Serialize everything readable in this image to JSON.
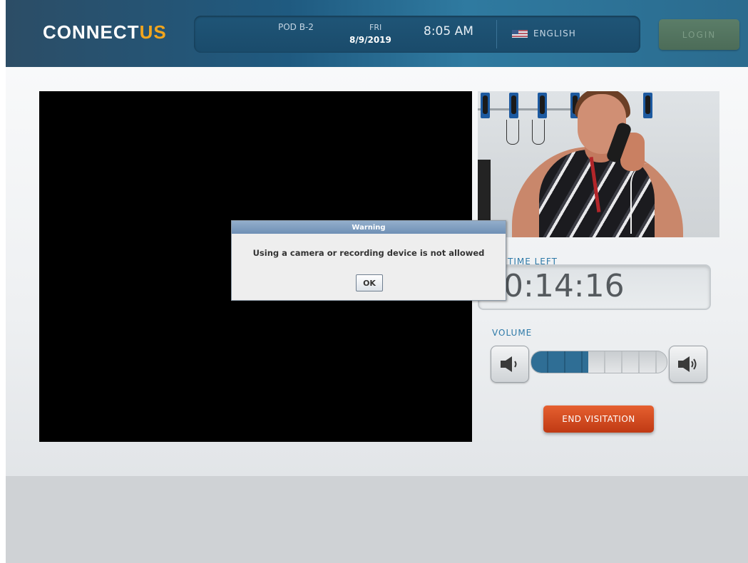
{
  "header": {
    "logo_part1": "CONNECT",
    "logo_part2": "US",
    "location": "POD B-2",
    "day": "FRI",
    "date": "8/9/2019",
    "time": "8:05 AM",
    "language": "ENGLISH",
    "language_flag_icon": "us-flag-icon",
    "login_label": "LOGIN"
  },
  "session": {
    "time_left_label": "TIME LEFT",
    "time_left_value": "0:14:16",
    "volume_label": "VOLUME",
    "volume_level": 0.42,
    "volume_down_icon": "speaker-low-icon",
    "volume_up_icon": "speaker-high-icon",
    "end_label": "END VISITATION"
  },
  "dialog": {
    "title": "Warning",
    "message": "Using a camera or recording device is not allowed",
    "ok_label": "OK"
  },
  "colors": {
    "header": "#1f5a80",
    "accent_logo": "#f2a51d",
    "label_blue": "#2e7aa8",
    "end_button": "#d2491f",
    "login_button": "#5b7d68"
  }
}
